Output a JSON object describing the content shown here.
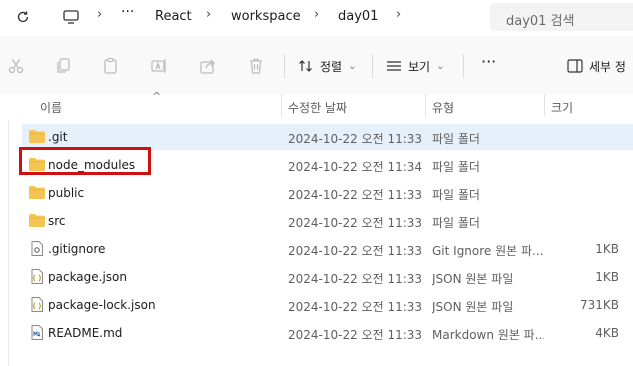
{
  "breadcrumb": {
    "items": [
      "React",
      "workspace",
      "day01"
    ]
  },
  "search": {
    "placeholder": "day01 검색"
  },
  "toolbar": {
    "sort_label": "정렬",
    "view_label": "보기",
    "more_label": "···",
    "details_label": "세부 정"
  },
  "columns": {
    "name": "이름",
    "modified": "수정한 날짜",
    "type": "유형",
    "size": "크기"
  },
  "files": [
    {
      "name": ".git",
      "modified": "2024-10-22 오전 11:33",
      "type": "파일 폴더",
      "size": "",
      "icon": "folder-icon",
      "selected": true
    },
    {
      "name": "node_modules",
      "modified": "2024-10-22 오전 11:34",
      "type": "파일 폴더",
      "size": "",
      "icon": "folder-icon",
      "selected": false
    },
    {
      "name": "public",
      "modified": "2024-10-22 오전 11:33",
      "type": "파일 폴더",
      "size": "",
      "icon": "folder-icon",
      "selected": false
    },
    {
      "name": "src",
      "modified": "2024-10-22 오전 11:33",
      "type": "파일 폴더",
      "size": "",
      "icon": "folder-icon",
      "selected": false
    },
    {
      "name": ".gitignore",
      "modified": "2024-10-22 오전 11:33",
      "type": "Git Ignore 원본 파...",
      "size": "1KB",
      "icon": "settings-file-icon",
      "selected": false
    },
    {
      "name": "package.json",
      "modified": "2024-10-22 오전 11:33",
      "type": "JSON 원본 파일",
      "size": "1KB",
      "icon": "json-file-icon",
      "selected": false
    },
    {
      "name": "package-lock.json",
      "modified": "2024-10-22 오전 11:33",
      "type": "JSON 원본 파일",
      "size": "731KB",
      "icon": "json-file-icon",
      "selected": false
    },
    {
      "name": "README.md",
      "modified": "2024-10-22 오전 11:33",
      "type": "Markdown 원본 파...",
      "size": "4KB",
      "icon": "markdown-file-icon",
      "selected": false
    }
  ],
  "colors": {
    "selection": "#e6f0fb",
    "highlight_box": "#d10f0f",
    "folder": "#f4c553"
  }
}
